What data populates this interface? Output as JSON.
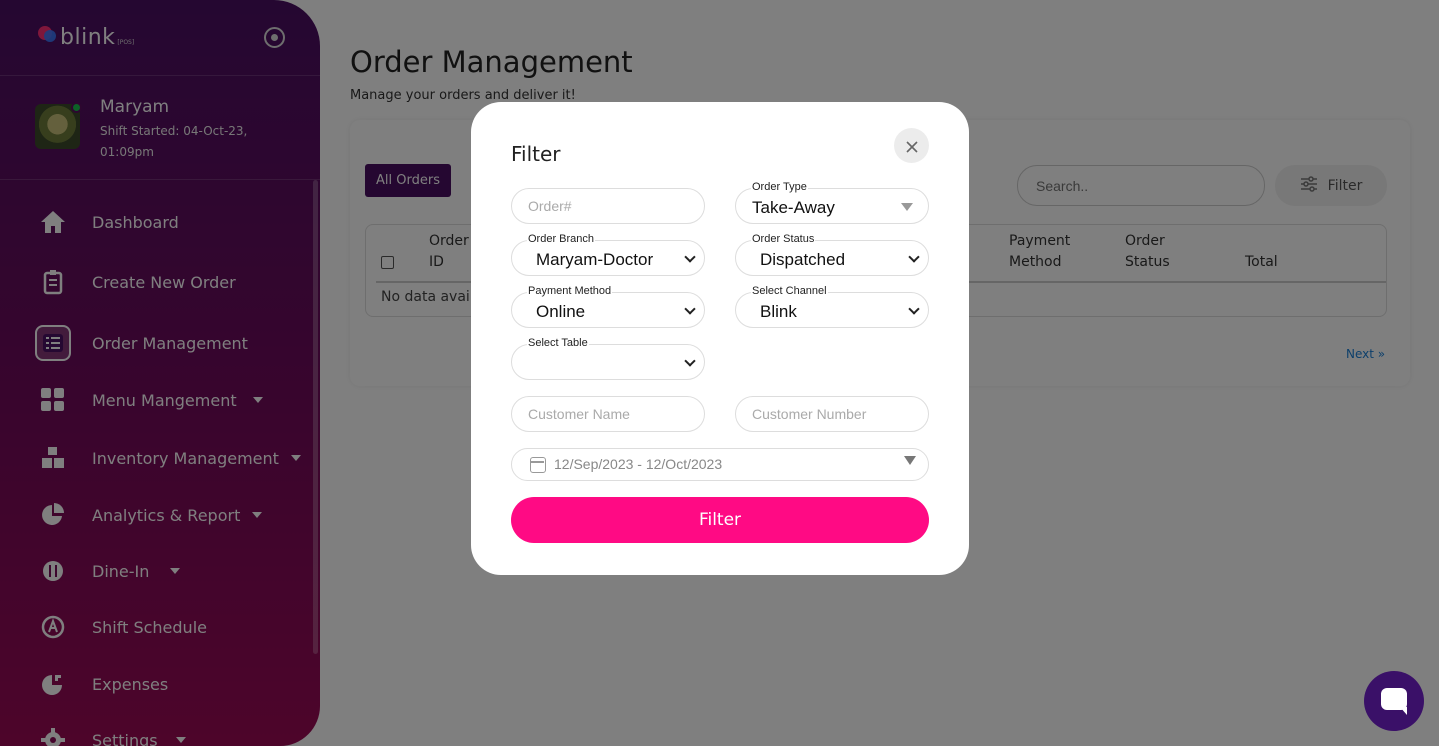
{
  "app": {
    "logo_text": "blink",
    "logo_sub": "[POS]"
  },
  "user": {
    "name": "Maryam",
    "shift": "Shift Started: 04-Oct-23, 01:09pm"
  },
  "sidebar": {
    "items": [
      {
        "label": "Dashboard",
        "icon": "home-icon"
      },
      {
        "label": "Create New Order",
        "icon": "receipt-icon"
      },
      {
        "label": "Order Management",
        "icon": "list-icon",
        "active": true
      },
      {
        "label": "Menu Mangement",
        "icon": "grid-icon",
        "has_submenu": true
      },
      {
        "label": "Inventory Management",
        "icon": "boxes-icon",
        "has_submenu": true
      },
      {
        "label": "Analytics & Report",
        "icon": "pie-chart-icon",
        "has_submenu": true
      },
      {
        "label": "Dine-In",
        "icon": "dine-in-icon",
        "has_submenu": true
      },
      {
        "label": "Shift Schedule",
        "icon": "schedule-icon"
      },
      {
        "label": "Expenses",
        "icon": "expenses-icon"
      },
      {
        "label": "Settings",
        "icon": "gear-icon",
        "has_submenu": true
      }
    ]
  },
  "main": {
    "title": "Order Management",
    "subtitle": "Manage your orders and deliver it!",
    "tab_all": "All Orders",
    "search_placeholder": "Search..",
    "filter_label": "Filter",
    "table": {
      "headers": [
        {
          "line1": "Order",
          "line2": "ID"
        },
        {
          "line1": "Payment",
          "line2": "Method"
        },
        {
          "line1": "Order",
          "line2": "Status"
        },
        {
          "line1": "",
          "line2": "Total"
        }
      ],
      "empty_text": "No data avai"
    },
    "next_label": "Next »"
  },
  "modal": {
    "title": "Filter",
    "order_no_placeholder": "Order#",
    "order_type": {
      "label": "Order Type",
      "value": "Take-Away"
    },
    "order_branch": {
      "label": "Order Branch",
      "value": "Maryam-Doctor"
    },
    "order_status": {
      "label": "Order Status",
      "value": "Dispatched"
    },
    "payment_method": {
      "label": "Payment Method",
      "value": "Online"
    },
    "channel": {
      "label": "Select Channel",
      "value": "Blink"
    },
    "table": {
      "label": "Select Table",
      "value": ""
    },
    "customer_name_placeholder": "Customer Name",
    "customer_number_placeholder": "Customer Number",
    "date_range": "12/Sep/2023 - 12/Oct/2023",
    "apply_label": "Filter"
  },
  "colors": {
    "primary": "#4a0f63",
    "accent": "#ff0a84",
    "online": "#1bc24f"
  }
}
